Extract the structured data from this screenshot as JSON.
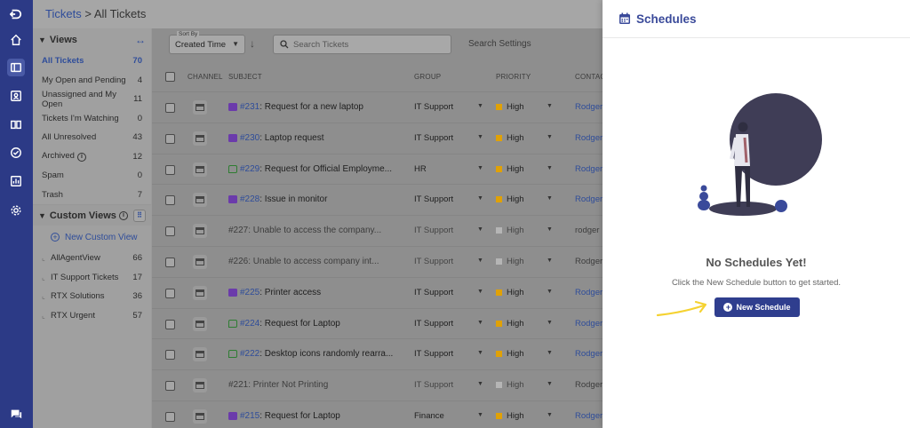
{
  "breadcrumb": {
    "link": "Tickets",
    "separator": " > ",
    "current": "All Tickets"
  },
  "views": {
    "title": "Views",
    "items": [
      {
        "label": "All Tickets",
        "count": "70"
      },
      {
        "label": "My Open and Pending",
        "count": "4"
      },
      {
        "label": "Unassigned and My Open",
        "count": "11"
      },
      {
        "label": "Tickets I'm Watching",
        "count": "0"
      },
      {
        "label": "All Unresolved",
        "count": "43"
      },
      {
        "label": "Archived",
        "count": "12"
      },
      {
        "label": "Spam",
        "count": "0"
      },
      {
        "label": "Trash",
        "count": "7"
      }
    ]
  },
  "custom_views": {
    "title": "Custom Views",
    "new_label": "New Custom View",
    "items": [
      {
        "label": "AllAgentView",
        "count": "66"
      },
      {
        "label": "IT Support Tickets",
        "count": "17"
      },
      {
        "label": "RTX Solutions",
        "count": "36"
      },
      {
        "label": "RTX Urgent",
        "count": "57"
      }
    ]
  },
  "toolbar": {
    "sort_label": "Sort By",
    "sort_value": "Created Time",
    "search_placeholder": "Search Tickets",
    "search_settings": "Search Settings"
  },
  "table": {
    "headers": {
      "channel": "CHANNEL",
      "subject": "SUBJECT",
      "group": "GROUP",
      "priority": "PRIORITY",
      "contact": "CONTAC"
    },
    "rows": [
      {
        "type": "email",
        "id": "#231",
        "subject": ": Request for a new laptop",
        "group": "IT Support",
        "priority": "High",
        "contact": "Rodger",
        "faded": false
      },
      {
        "type": "email",
        "id": "#230",
        "subject": ": Laptop request",
        "group": "IT Support",
        "priority": "High",
        "contact": "Rodger",
        "faded": false
      },
      {
        "type": "chat",
        "id": "#229",
        "subject": ": Request for Official Employme...",
        "group": "HR",
        "priority": "High",
        "contact": "Rodger",
        "faded": false
      },
      {
        "type": "email",
        "id": "#228",
        "subject": ": Issue in monitor",
        "group": "IT Support",
        "priority": "High",
        "contact": "Rodger",
        "faded": false
      },
      {
        "type": "none",
        "id": "#227",
        "subject": ": Unable to access the company...",
        "group": "IT Support",
        "priority": "High",
        "contact": "rodger",
        "faded": true
      },
      {
        "type": "none",
        "id": "#226",
        "subject": ": Unable to access company int...",
        "group": "IT Support",
        "priority": "High",
        "contact": "Rodger",
        "faded": true
      },
      {
        "type": "email",
        "id": "#225",
        "subject": ": Printer access",
        "group": "IT Support",
        "priority": "High",
        "contact": "Rodger",
        "faded": false
      },
      {
        "type": "chat",
        "id": "#224",
        "subject": ": Request for Laptop",
        "group": "IT Support",
        "priority": "High",
        "contact": "Rodger",
        "faded": false
      },
      {
        "type": "chat",
        "id": "#222",
        "subject": ": Desktop icons randomly rearra...",
        "group": "IT Support",
        "priority": "High",
        "contact": "Rodger",
        "faded": false
      },
      {
        "type": "none",
        "id": "#221",
        "subject": ": Printer Not Printing",
        "group": "IT Support",
        "priority": "High",
        "contact": "Rodger",
        "faded": true
      },
      {
        "type": "email",
        "id": "#215",
        "subject": ": Request for Laptop",
        "group": "Finance",
        "priority": "High",
        "contact": "Rodger",
        "faded": false
      }
    ]
  },
  "colors": {
    "accent": "#2f3e8e",
    "priority_high": "#e0a106",
    "priority_faded": "#b5b5b5",
    "arrow": "#f5d231"
  },
  "drawer": {
    "title": "Schedules",
    "empty_title": "No Schedules Yet!",
    "empty_hint": "Click the New Schedule button to get started.",
    "button_label": "New Schedule"
  }
}
